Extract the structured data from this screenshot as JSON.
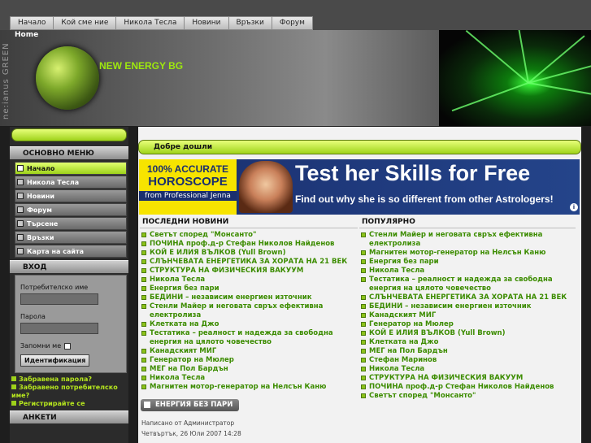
{
  "topnav": [
    "Начало",
    "Кой сме ние",
    "Никола Тесла",
    "Новини",
    "Връзки",
    "Форум"
  ],
  "header": {
    "breadcrumb": "Home",
    "site_title": "NEW ENERGY BG",
    "side_brand": "ne:ianus GREEN"
  },
  "sidebar": {
    "menu_title": "ОСНОВНО МЕНЮ",
    "menu_items": [
      "Начало",
      "Никола Тесла",
      "Новини",
      "Форум",
      "Търсене",
      "Връзки",
      "Карта на сайта"
    ],
    "login_title": "ВХОД",
    "username_label": "Потребителско име",
    "password_label": "Парола",
    "remember_label": "Запомни ме",
    "login_button": "Идентификация",
    "links": [
      "Забравена парола?",
      "Забравено потребителско име?",
      "Регистрирайте се"
    ],
    "polls_title": "АНКЕТИ"
  },
  "main": {
    "welcome": "Добре дошли",
    "ad": {
      "left_line1": "100% ACCURATE",
      "left_line2": "HOROSCOPE",
      "left_line3": "from Professional Jenna",
      "headline": "Test her Skills for Free",
      "subline": "Find out why she is so different from other Astrologers!",
      "info": "i"
    },
    "latest_title": "ПОСЛЕДНИ НОВИНИ",
    "latest": [
      "Светът според \"Монсанто\"",
      "ПОЧИНА проф.д-р Стефан Николов Найденов",
      "КОЙ Е ИЛИЯ ВЪЛКОВ (Yull Brown)",
      "СЛЪНЧЕВАТА ЕНЕРГЕТИКА ЗА ХОРАТА НА 21 ВЕК",
      "СТРУКТУРА НА ФИЗИЧЕСКИЯ ВАКУУМ",
      "Никола Тесла",
      "Енергия без пари",
      "БЕДИНИ – независим енергиен източник",
      "Стенли Майер и неговата свръх ефективна електролиза",
      "Клетката на Джо",
      "Тестатика – реалност и надежда за свободна енергия на цялото човечество",
      "Канадският МИГ",
      "Генератор на Мюлер",
      "МЕГ на Пол Бардън",
      "Никола Тесла",
      "Магнитен мотор-генератор на Нелсън Каню"
    ],
    "popular_title": "ПОПУЛЯРНО",
    "popular": [
      "Стенли Майер и неговата свръх ефективна електролиза",
      "Магнитен мотор-генератор на Нелсън Каню",
      "Енергия без пари",
      "Никола Тесла",
      "Тестатика – реалност и надежда за свободна енергия на цялото човечество",
      "СЛЪНЧЕВАТА ЕНЕРГЕТИКА ЗА ХОРАТА НА 21 ВЕК",
      "БЕДИНИ – независим енергиен източник",
      "Канадският МИГ",
      "Генератор на Мюлер",
      "КОЙ Е ИЛИЯ ВЪЛКОВ (Yull Brown)",
      "Клетката на Джо",
      "МЕГ на Пол Бардън",
      "Стефан Маринов",
      "Никола Тесла",
      "СТРУКТУРА НА ФИЗИЧЕСКИЯ ВАКУУМ",
      "ПОЧИНА проф.д-р Стефан Николов Найденов",
      "Светът според \"Монсанто\""
    ],
    "section_button": "ЕНЕРГИЯ БЕЗ ПАРИ",
    "author_line": "Написано от Администратор",
    "date_line": "Четвъртък, 26 Юли 2007 14:28"
  },
  "colors": {
    "accent": "#9ed21a",
    "link": "#3c8c00",
    "dark": "#2b2b2b"
  }
}
